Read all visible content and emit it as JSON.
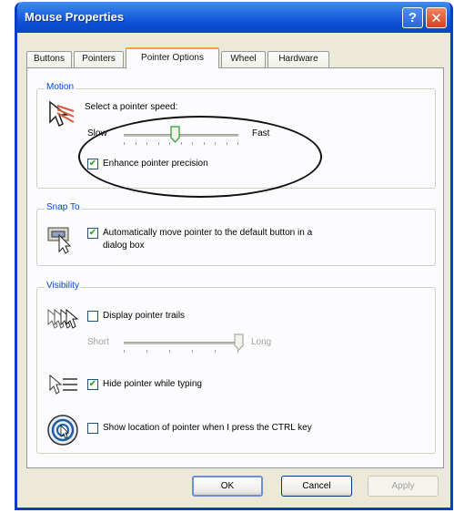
{
  "window": {
    "title": "Mouse Properties",
    "help_glyph": "?",
    "close_glyph": "✕"
  },
  "tabs": [
    {
      "label": "Buttons"
    },
    {
      "label": "Pointers"
    },
    {
      "label": "Pointer Options",
      "active": true
    },
    {
      "label": "Wheel"
    },
    {
      "label": "Hardware"
    }
  ],
  "motion": {
    "group_label": "Motion",
    "speed_label": "Select a pointer speed:",
    "slow_label": "Slow",
    "fast_label": "Fast",
    "speed_level": 0.45,
    "enhance_label": "Enhance pointer precision",
    "enhance_checked": true
  },
  "snap_to": {
    "group_label": "Snap To",
    "snap_label_line1": "Automatically move pointer to the default button in a",
    "snap_label_line2": "dialog box",
    "snap_checked": true
  },
  "visibility": {
    "group_label": "Visibility",
    "trails_label": "Display pointer trails",
    "trails_checked": false,
    "short_label": "Short",
    "long_label": "Long",
    "trail_level": 1.0,
    "hide_label": "Hide pointer while typing",
    "hide_checked": true,
    "show_location_label": "Show location of pointer when I press the CTRL key",
    "show_location_checked": false
  },
  "footer": {
    "ok_label": "OK",
    "cancel_label": "Cancel",
    "apply_label": "Apply"
  },
  "colors": {
    "titlebar": "#0b4fd6",
    "group_label": "#0046d5",
    "active_tab_accent": "#f7a33a",
    "checkmark": "#21a121"
  }
}
